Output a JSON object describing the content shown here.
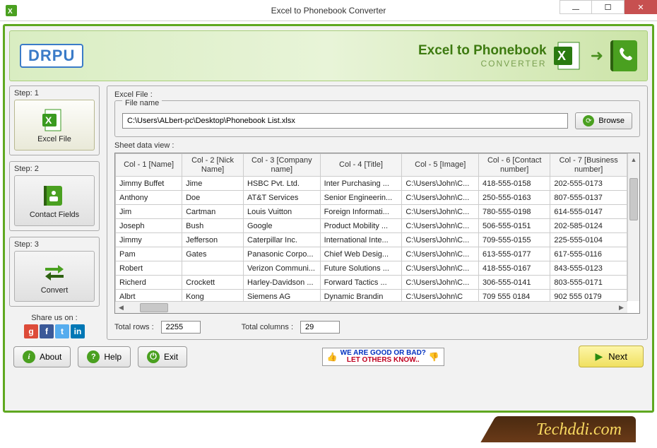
{
  "window": {
    "title": "Excel to Phonebook Converter"
  },
  "banner": {
    "logo_text": "DRPU",
    "title_part1": "Excel to ",
    "title_part2": "Phonebook",
    "subtitle": "CONVERTER"
  },
  "sidebar": {
    "steps": [
      {
        "label": "Step: 1",
        "button": "Excel File"
      },
      {
        "label": "Step: 2",
        "button": "Contact Fields"
      },
      {
        "label": "Step: 3",
        "button": "Convert"
      }
    ],
    "share_label": "Share us on :"
  },
  "main": {
    "excel_file_label": "Excel File :",
    "file_name_label": "File name",
    "file_path": "C:\\Users\\ALbert-pc\\Desktop\\Phonebook List.xlsx",
    "browse_label": "Browse",
    "sheet_label": "Sheet data view :",
    "columns": [
      "Col - 1 [Name]",
      "Col - 2 [Nick Name]",
      "Col - 3 [Company name]",
      "Col - 4 [Title]",
      "Col - 5 [Image]",
      "Col - 6 [Contact number]",
      "Col - 7 [Business number]"
    ],
    "rows": [
      [
        "Jimmy Buffet",
        "Jime",
        "HSBC Pvt. Ltd.",
        "Inter Purchasing ...",
        "C:\\Users\\John\\C...",
        "418-555-0158",
        "202-555-0173"
      ],
      [
        "Anthony",
        "Doe",
        "AT&T Services",
        "Senior Engineerin...",
        "C:\\Users\\John\\C...",
        "250-555-0163",
        "807-555-0137"
      ],
      [
        "Jim",
        "Cartman",
        "Louis Vuitton",
        "Foreign Informati...",
        "C:\\Users\\John\\C...",
        "780-555-0198",
        "614-555-0147"
      ],
      [
        "Joseph",
        "Bush",
        "Google",
        "Product Mobility ...",
        "C:\\Users\\John\\C...",
        "506-555-0151",
        "202-585-0124"
      ],
      [
        "Jimmy",
        "Jefferson",
        "Caterpillar Inc.",
        "International Inte...",
        "C:\\Users\\John\\C...",
        "709-555-0155",
        "225-555-0104"
      ],
      [
        "Pam",
        "Gates",
        "Panasonic Corpo...",
        "Chief Web Desig...",
        "C:\\Users\\John\\C...",
        "613-555-0177",
        "617-555-0116"
      ],
      [
        "Robert",
        "",
        "Verizon Communi...",
        "Future Solutions ...",
        "C:\\Users\\John\\C...",
        "418-555-0167",
        "843-555-0123"
      ],
      [
        "Richerd",
        "Crockett",
        "Harley-Davidson ...",
        "Forward Tactics ...",
        "C:\\Users\\John\\C...",
        "306-555-0141",
        "803-555-0171"
      ],
      [
        "Albrt",
        "Kong",
        "Siemens AG",
        "Dynamic Brandin",
        "C:\\Users\\John\\C",
        "709 555 0184",
        "902 555 0179"
      ]
    ],
    "total_rows_label": "Total rows :",
    "total_rows": "2255",
    "total_cols_label": "Total columns :",
    "total_cols": "29"
  },
  "footer": {
    "about": "About",
    "help": "Help",
    "exit": "Exit",
    "feedback_line1": "WE ARE GOOD OR BAD?",
    "feedback_line2": "LET OTHERS KNOW..",
    "next": "Next"
  },
  "watermark": "Techddi.com"
}
